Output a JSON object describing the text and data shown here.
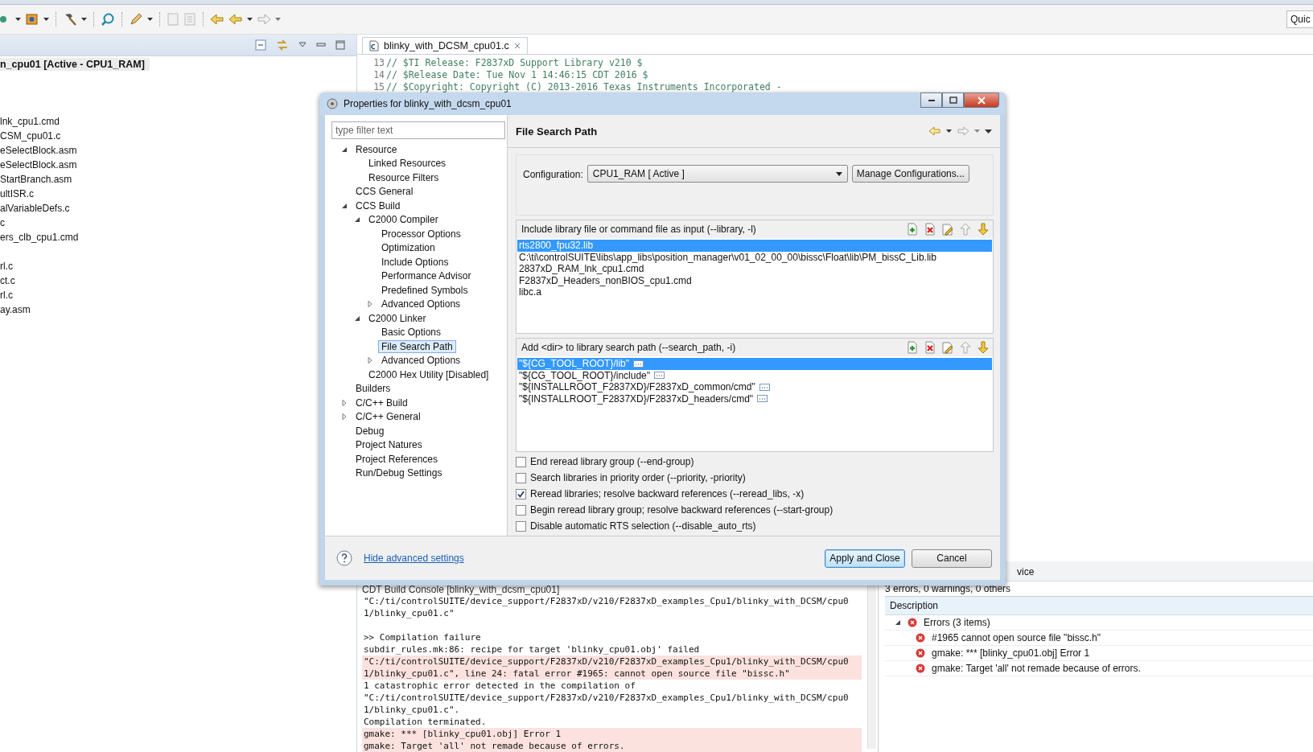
{
  "toolbar": {
    "quick_access": "Quic"
  },
  "explorer": {
    "project": "n_cpu01  [Active - CPU1_RAM]",
    "items": [
      "lnk_cpu1.cmd",
      "CSM_cpu01.c",
      "eSelectBlock.asm",
      "eSelectBlock.asm",
      "StartBranch.asm",
      "ultISR.c",
      "alVariableDefs.c",
      "c",
      "ers_clb_cpu1.cmd",
      "rl.c",
      "ct.c",
      "rl.c",
      "ay.asm"
    ]
  },
  "editor": {
    "tab": "blinky_with_DCSM_cpu01.c",
    "lines": [
      {
        "number": "13",
        "code": "// $TI Release: F2837xD Support Library v210 $"
      },
      {
        "number": "14",
        "code": "// $Release Date: Tue Nov  1 14:46:15 CDT 2016 $"
      },
      {
        "number": "15",
        "code": "// $Copyright: Copyright (C) 2013-2016 Texas Instruments Incorporated -"
      }
    ]
  },
  "console": {
    "title": "CDT Build Console [blinky_with_dcsm_cpu01]",
    "lines": [
      {
        "kind": "normal",
        "text": "\"C:/ti/controlSUITE/device_support/F2837xD/v210/F2837xD_examples_Cpu1/blinky_with_DCSM/cpu0"
      },
      {
        "kind": "normal",
        "text": "1/blinky_cpu01.c\""
      },
      {
        "kind": "blank"
      },
      {
        "kind": "normal",
        "text": ">> Compilation failure"
      },
      {
        "kind": "normal",
        "text": "subdir_rules.mk:86: recipe for target 'blinky_cpu01.obj' failed"
      },
      {
        "kind": "error",
        "text": "\"C:/ti/controlSUITE/device_support/F2837xD/v210/F2837xD_examples_Cpu1/blinky_with_DCSM/cpu0"
      },
      {
        "kind": "error",
        "text": "1/blinky_cpu01.c\", line 24: fatal error #1965: cannot open source file \"bissc.h\""
      },
      {
        "kind": "normal",
        "text": "1 catastrophic error detected in the compilation of"
      },
      {
        "kind": "normal",
        "text": "\"C:/ti/controlSUITE/device_support/F2837xD/v210/F2837xD_examples_Cpu1/blinky_with_DCSM/cpu0"
      },
      {
        "kind": "normal",
        "text": "1/blinky_cpu01.c\"."
      },
      {
        "kind": "normal",
        "text": "Compilation terminated."
      },
      {
        "kind": "error",
        "text": "gmake: *** [blinky_cpu01.obj] Error 1"
      },
      {
        "kind": "error",
        "text": "gmake: Target 'all' not remade because of errors."
      }
    ]
  },
  "problems": {
    "tab": "vice",
    "summary": "3 errors, 0 warnings, 0 others",
    "column": "Description",
    "group": {
      "label": "Errors (3 items)",
      "expanded": true,
      "items": [
        "#1965 cannot open source file \"bissc.h\"",
        "gmake: *** [blinky_cpu01.obj] Error 1",
        "gmake: Target 'all' not remade because of errors."
      ]
    }
  },
  "dialog": {
    "title": "Properties for blinky_with_dcsm_cpu01",
    "filter": {
      "placeholder": "type filter text"
    },
    "tree": [
      {
        "label": "Resource",
        "selected": false,
        "expanded": true,
        "children": [
          {
            "label": "Linked Resources",
            "selected": false
          },
          {
            "label": "Resource Filters",
            "selected": false
          }
        ]
      },
      {
        "label": "CCS General",
        "selected": false
      },
      {
        "label": "CCS Build",
        "selected": false,
        "expanded": true,
        "children": [
          {
            "label": "C2000 Compiler",
            "selected": false,
            "expanded": true,
            "children": [
              {
                "label": "Processor Options",
                "selected": false
              },
              {
                "label": "Optimization",
                "selected": false
              },
              {
                "label": "Include Options",
                "selected": false
              },
              {
                "label": "Performance Advisor",
                "selected": false
              },
              {
                "label": "Predefined Symbols",
                "selected": false
              },
              {
                "label": "Advanced Options",
                "selected": false,
                "expanded": false
              }
            ]
          },
          {
            "label": "C2000 Linker",
            "selected": false,
            "expanded": true,
            "children": [
              {
                "label": "Basic Options",
                "selected": false
              },
              {
                "label": "File Search Path",
                "selected": true
              },
              {
                "label": "Advanced Options",
                "selected": false,
                "expanded": false
              }
            ]
          },
          {
            "label": "C2000 Hex Utility  [Disabled]",
            "selected": false
          }
        ]
      },
      {
        "label": "Builders",
        "selected": false
      },
      {
        "label": "C/C++ Build",
        "selected": false,
        "expanded": false
      },
      {
        "label": "C/C++ General",
        "selected": false,
        "expanded": false
      },
      {
        "label": "Debug",
        "selected": false
      },
      {
        "label": "Project Natures",
        "selected": false
      },
      {
        "label": "Project References",
        "selected": false
      },
      {
        "label": "Run/Debug Settings",
        "selected": false
      }
    ],
    "page_title": "File Search Path",
    "configuration": {
      "label": "Configuration:",
      "value": "CPU1_RAM  [ Active ]",
      "button": "Manage Configurations..."
    },
    "lists": [
      {
        "title": "Include library file or command file as input (--library, -l)",
        "items": [
          {
            "text": "rts2800_fpu32.lib",
            "selected": true,
            "has_edit": false
          },
          {
            "text": "C:\\ti\\controlSUITE\\libs\\app_libs\\position_manager\\v01_02_00_00\\bissc\\Float\\lib\\PM_bissC_Lib.lib",
            "selected": false,
            "has_edit": false
          },
          {
            "text": "2837xD_RAM_lnk_cpu1.cmd",
            "selected": false,
            "has_edit": false
          },
          {
            "text": "F2837xD_Headers_nonBIOS_cpu1.cmd",
            "selected": false,
            "has_edit": false
          },
          {
            "text": "libc.a",
            "selected": false,
            "has_edit": false
          }
        ]
      },
      {
        "title": "Add <dir> to library search path (--search_path, -i)",
        "items": [
          {
            "text": "\"${CG_TOOL_ROOT}/lib\"",
            "selected": true,
            "has_edit": true
          },
          {
            "text": "\"${CG_TOOL_ROOT}/include\"",
            "selected": false,
            "has_edit": true
          },
          {
            "text": "\"${INSTALLROOT_F2837XD}/F2837xD_common/cmd\"",
            "selected": false,
            "has_edit": true
          },
          {
            "text": "\"${INSTALLROOT_F2837XD}/F2837xD_headers/cmd\"",
            "selected": false,
            "has_edit": true
          }
        ]
      }
    ],
    "options": [
      {
        "label": "End reread library group (--end-group)",
        "checked": false
      },
      {
        "label": "Search libraries in priority order (--priority, -priority)",
        "checked": false
      },
      {
        "label": "Reread libraries; resolve backward references (--reread_libs, -x)",
        "checked": true
      },
      {
        "label": "Begin reread library group; resolve backward references (--start-group)",
        "checked": false
      },
      {
        "label": "Disable automatic RTS selection (--disable_auto_rts)",
        "checked": false
      }
    ],
    "help_link": "Hide advanced settings",
    "buttons": [
      {
        "label": "Apply and Close",
        "default": true
      },
      {
        "label": "Cancel",
        "default": false
      }
    ]
  }
}
